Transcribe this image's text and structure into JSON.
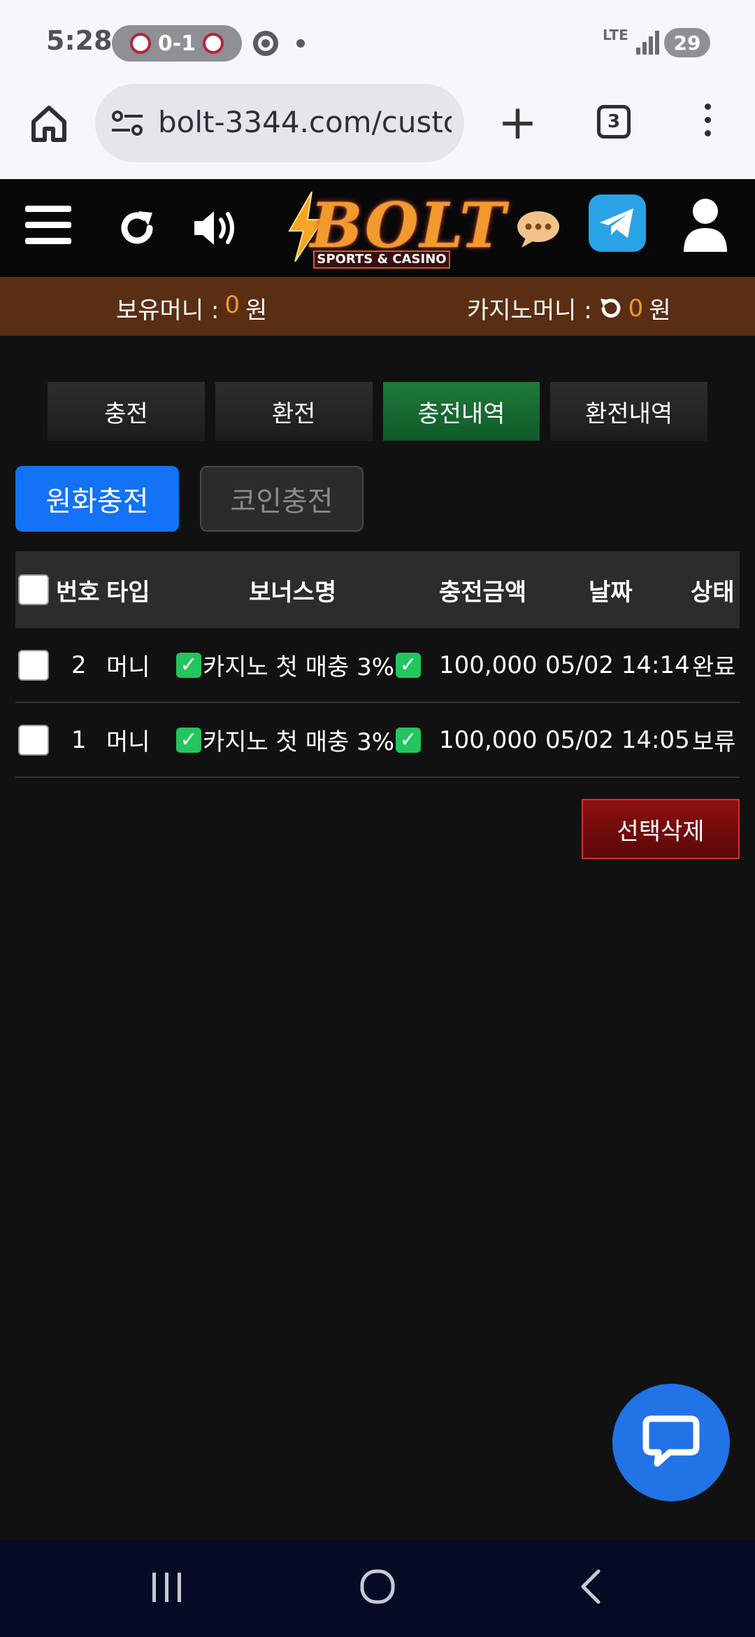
{
  "status_bar": {
    "time": "5:28",
    "score": "0-1",
    "network": "LTE",
    "battery": "29"
  },
  "browser": {
    "url": "bolt-3344.com/custc",
    "tab_count": "3"
  },
  "header": {
    "logo_text": "BOLT",
    "logo_subtitle": "SPORTS & CASINO"
  },
  "money": {
    "holding_label": "보유머니 :",
    "holding_value": "0",
    "holding_unit": "원",
    "casino_label": "카지노머니 :",
    "casino_value": "0",
    "casino_unit": "원"
  },
  "tabs": [
    {
      "label": "충전"
    },
    {
      "label": "환전"
    },
    {
      "label": "충전내역"
    },
    {
      "label": "환전내역"
    }
  ],
  "subtabs": {
    "won": "원화충전",
    "coin": "코인충전"
  },
  "table": {
    "headers": {
      "number": "번호",
      "type": "타입",
      "bonus": "보너스명",
      "amount": "충전금액",
      "date": "날짜",
      "status": "상태"
    },
    "rows": [
      {
        "number": "2",
        "type": "머니",
        "bonus": "카지노 첫 매충 3%",
        "amount": "100,000",
        "date": "05/02 14:14",
        "status": "완료"
      },
      {
        "number": "1",
        "type": "머니",
        "bonus": "카지노 첫 매충 3%",
        "amount": "100,000",
        "date": "05/02 14:05",
        "status": "보류"
      }
    ]
  },
  "actions": {
    "delete_selected": "선택삭제"
  },
  "colors": {
    "accent_blue": "#1372f5",
    "active_tab_green": "#1f7a3c",
    "money_bar_brown": "#5a2e12",
    "highlight_orange": "#f39a2c",
    "delete_red": "#8e1010"
  }
}
